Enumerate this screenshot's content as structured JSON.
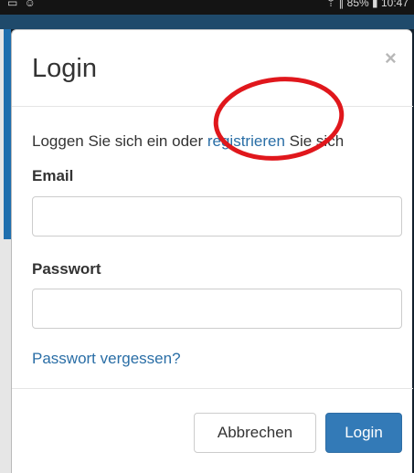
{
  "status_bar": {
    "left_icons": "▭ ☺",
    "right_text": "⇡ ∥ 85% ▮ 10:47"
  },
  "modal": {
    "title": "Login",
    "close_symbol": "×",
    "intro": {
      "before": "Loggen Sie sich ein oder ",
      "link": "registrieren",
      "after": " Sie sich"
    },
    "email_label": "Email",
    "email_value": "",
    "email_placeholder": "",
    "password_label": "Passwort",
    "password_value": "",
    "password_placeholder": "",
    "forgot_link": "Passwort vergessen?",
    "cancel_label": "Abbrechen",
    "login_label": "Login"
  },
  "colors": {
    "link": "#2a6ea6",
    "primary_button": "#337ab7",
    "annotation": "#e0171c"
  },
  "annotation": {
    "shape": "red-ellipse-highlight",
    "target": "registrieren-link"
  }
}
